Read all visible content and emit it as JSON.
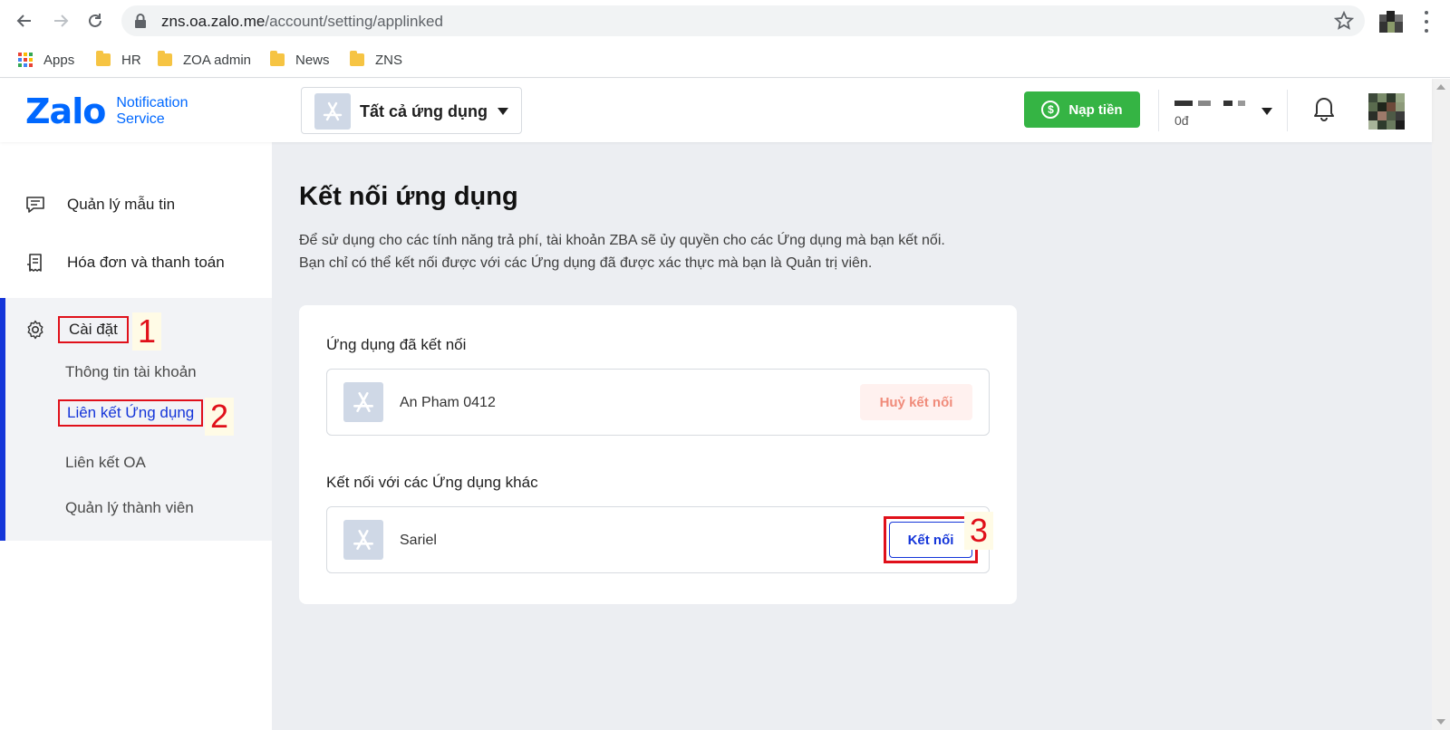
{
  "browser": {
    "url_host": "zns.oa.zalo.me",
    "url_path": "/account/setting/applinked",
    "bookmarks": [
      {
        "label": "Apps"
      },
      {
        "label": "HR"
      },
      {
        "label": "ZOA admin"
      },
      {
        "label": "News"
      },
      {
        "label": "ZNS"
      }
    ]
  },
  "header": {
    "logo_text": "Zalo",
    "logo_sub_1": "Notification",
    "logo_sub_2": "Service",
    "app_selector": "Tất cả ứng dụng",
    "topup_label": "Nạp tiền",
    "topup_symbol": "$",
    "balance": "0đ"
  },
  "sidebar": {
    "items": [
      {
        "label": "Quản lý mẫu tin"
      },
      {
        "label": "Hóa đơn và thanh toán"
      }
    ],
    "settings": {
      "label": "Cài đặt",
      "sub_items": [
        {
          "label": "Thông tin tài khoản"
        },
        {
          "label": "Liên kết Ứng dụng"
        },
        {
          "label": "Liên kết OA"
        },
        {
          "label": "Quản lý thành viên"
        }
      ]
    }
  },
  "callouts": [
    "1",
    "2",
    "3"
  ],
  "main": {
    "title": "Kết nối ứng dụng",
    "desc_line_1": "Để sử dụng cho các tính năng trả phí, tài khoản ZBA sẽ ủy quyền cho các Ứng dụng mà bạn kết nối.",
    "desc_line_2": "Bạn chỉ có thể kết nối được với các Ứng dụng đã được xác thực mà bạn là Quản trị viên.",
    "connected_title": "Ứng dụng đã kết nối",
    "connected_app": "An Pham 0412",
    "disconnect_label": "Huỷ kết nối",
    "other_title": "Kết nối với các Ứng dụng khác",
    "other_app": "Sariel",
    "connect_label": "Kết nối"
  },
  "colors": {
    "brand_blue": "#0068ff",
    "accent_blue": "#1435d9",
    "topup_green": "#35b444",
    "annotation_red": "#e0101a"
  }
}
